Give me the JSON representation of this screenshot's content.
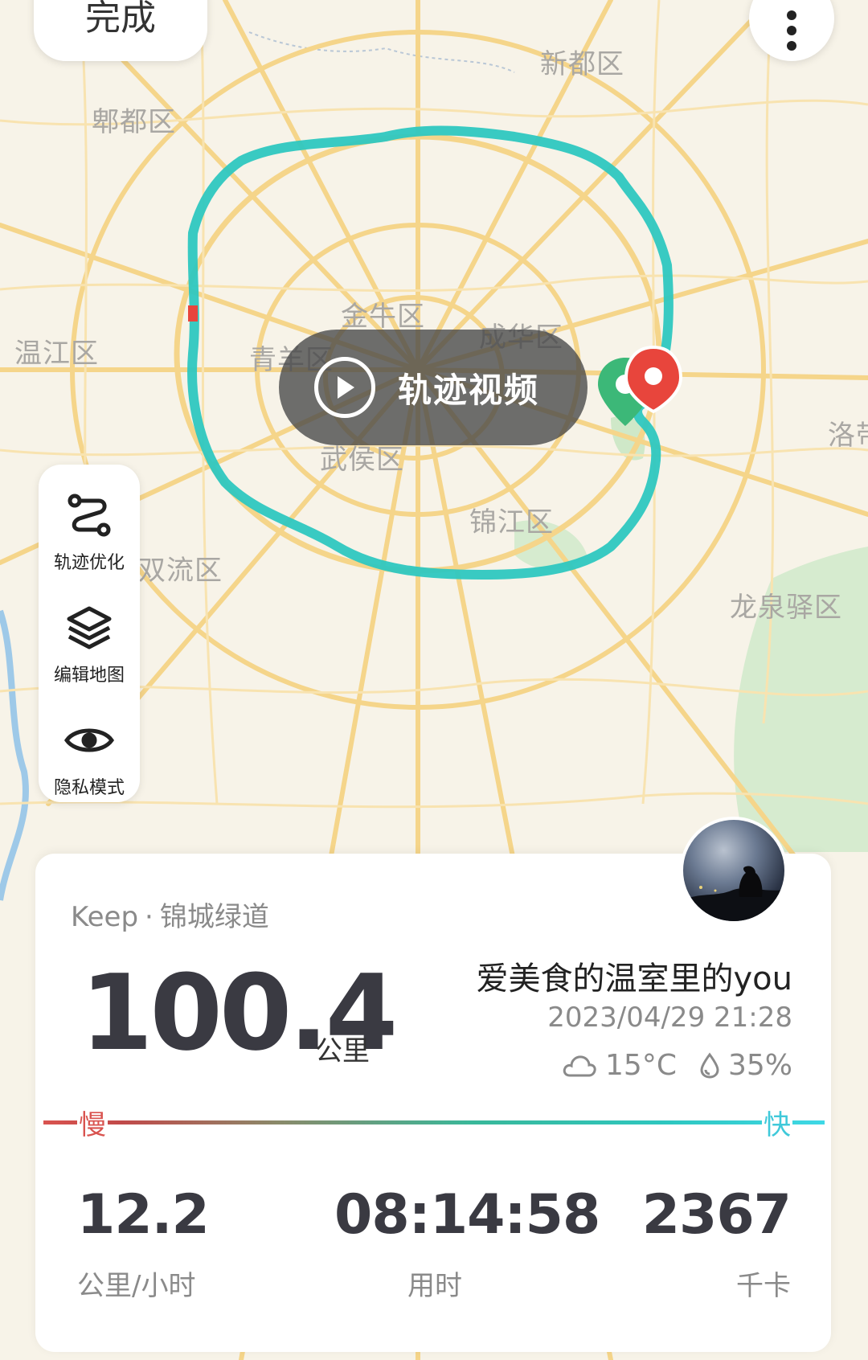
{
  "header": {
    "done_label": "完成",
    "more_icon": "more-vertical-icon"
  },
  "map": {
    "districts": [
      {
        "id": "xindu",
        "name": "新都区"
      },
      {
        "id": "pidu",
        "name": "郫都区"
      },
      {
        "id": "wenjiang",
        "name": "温江区"
      },
      {
        "id": "jinniu",
        "name": "金牛区"
      },
      {
        "id": "chenghua",
        "name": "成华区"
      },
      {
        "id": "qingyang",
        "name": "青羊区"
      },
      {
        "id": "wuhou",
        "name": "武侯区"
      },
      {
        "id": "jinjiang",
        "name": "锦江区"
      },
      {
        "id": "shuangliu",
        "name": "双流区"
      },
      {
        "id": "longquanyi",
        "name": "龙泉驿区"
      },
      {
        "id": "luo",
        "name": "洛带"
      }
    ],
    "colors": {
      "background": "#f7f3e8",
      "road": "#f5d58a",
      "route": "#2ec7c0",
      "start_marker": "#3cb878",
      "end_marker": "#e8453c"
    }
  },
  "video_button": {
    "label": "轨迹视频",
    "icon": "play-icon"
  },
  "tools": [
    {
      "label": "轨迹优化",
      "icon": "route-optimize-icon"
    },
    {
      "label": "编辑地图",
      "icon": "layers-icon"
    },
    {
      "label": "隐私模式",
      "icon": "eye-icon"
    }
  ],
  "card": {
    "app_name": "Keep",
    "separator": "·",
    "route_name": "锦城绿道",
    "distance": "100.4",
    "distance_unit": "公里",
    "username": "爱美食的温室里的you",
    "datetime": "2023/04/29 21:28",
    "temperature": "15°C",
    "humidity": "35%",
    "pace_slow_label": "慢",
    "pace_fast_label": "快",
    "metrics": {
      "speed": {
        "value": "12.2",
        "unit": "公里/小时"
      },
      "duration": {
        "value": "08:14:58",
        "unit": "用时"
      },
      "calories": {
        "value": "2367",
        "unit": "千卡"
      }
    }
  }
}
